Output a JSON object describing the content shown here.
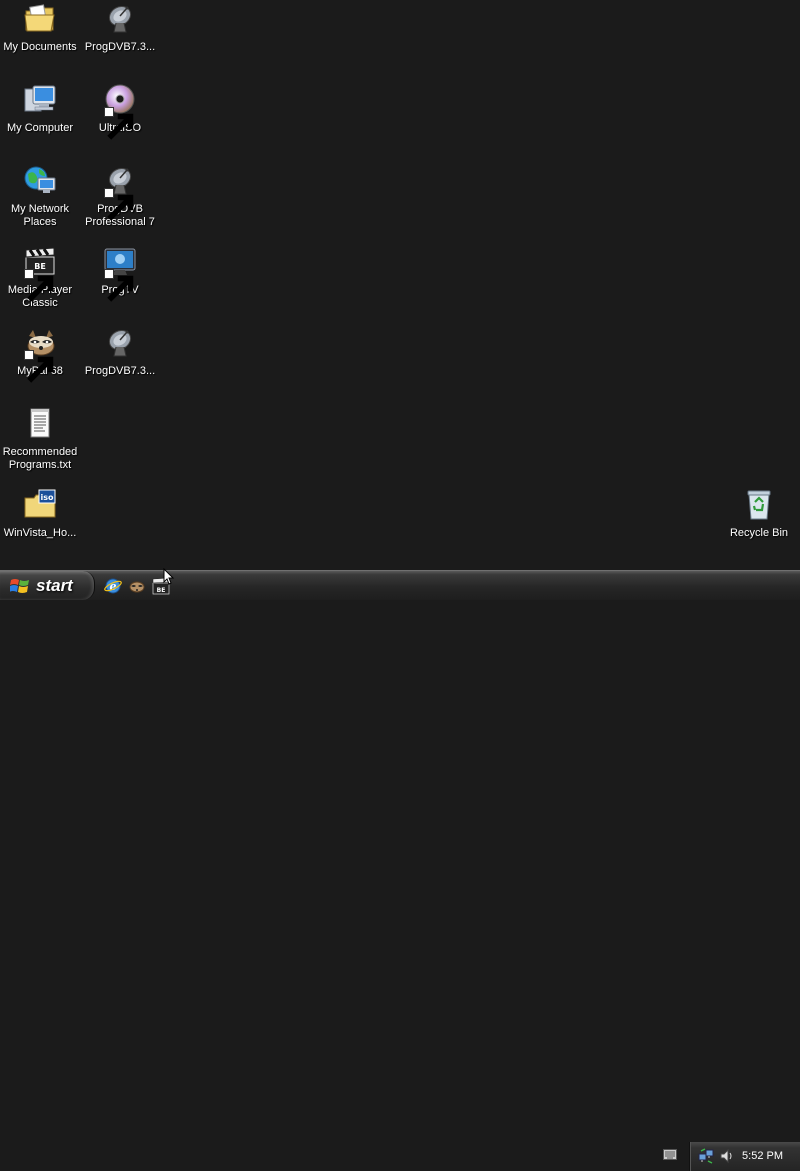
{
  "desktop": {
    "icons": [
      {
        "label": "My Documents",
        "icon": "my-documents-folder-icon"
      },
      {
        "label": "My Computer",
        "icon": "my-computer-icon"
      },
      {
        "label": "My Network Places",
        "icon": "network-places-icon"
      },
      {
        "label": "Media Player Classic",
        "icon": "clapperboard-icon"
      },
      {
        "label": "MyPal 68",
        "icon": "raccoon-icon"
      },
      {
        "label": "Recommended Programs.txt",
        "icon": "text-document-icon"
      },
      {
        "label": "WinVista_Ho...",
        "icon": "iso-folder-icon"
      },
      {
        "label": "ProgDVB7.3...",
        "icon": "satellite-dish-icon"
      },
      {
        "label": "UltraISO",
        "icon": "disc-icon"
      },
      {
        "label": "ProgDVB Professional 7",
        "icon": "satellite-dish-icon"
      },
      {
        "label": "ProgTV",
        "icon": "tv-monitor-icon"
      },
      {
        "label": "ProgDVB7.3...",
        "icon": "satellite-dish-icon"
      },
      {
        "label": "Recycle Bin",
        "icon": "recycle-bin-icon"
      }
    ]
  },
  "taskbar": {
    "start_label": "start",
    "quick_launch": [
      "ie-icon",
      "mypal-raccoon-icon",
      "media-player-classic-icon"
    ],
    "tray": {
      "clock": "5:52 PM",
      "icons": [
        "keyboard-icon",
        "network-icon",
        "speaker-icon"
      ]
    }
  },
  "colors": {
    "desktop_background": "#1b1b1b",
    "label_text": "#ffffff",
    "taskbar": "#262626"
  }
}
